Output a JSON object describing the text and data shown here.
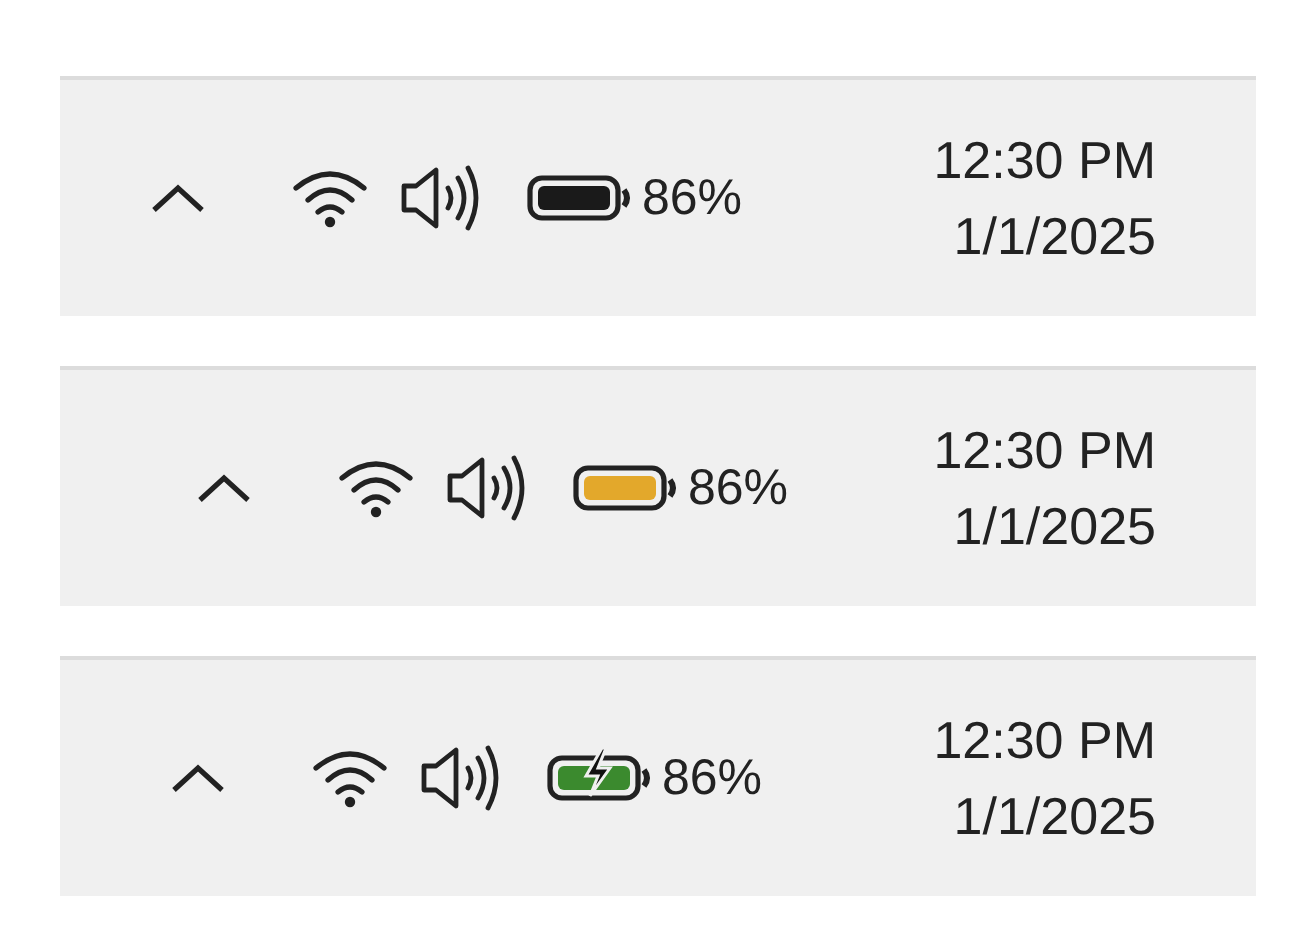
{
  "trays": [
    {
      "battery": {
        "color": "#1a1a1a",
        "charging": false,
        "percent": "86%"
      },
      "time": "12:30 PM",
      "date": "1/1/2025"
    },
    {
      "battery": {
        "color": "#e3a82b",
        "charging": false,
        "percent": "86%"
      },
      "time": "12:30 PM",
      "date": "1/1/2025"
    },
    {
      "battery": {
        "color": "#3b8a2e",
        "charging": true,
        "percent": "86%"
      },
      "time": "12:30 PM",
      "date": "1/1/2025"
    }
  ]
}
